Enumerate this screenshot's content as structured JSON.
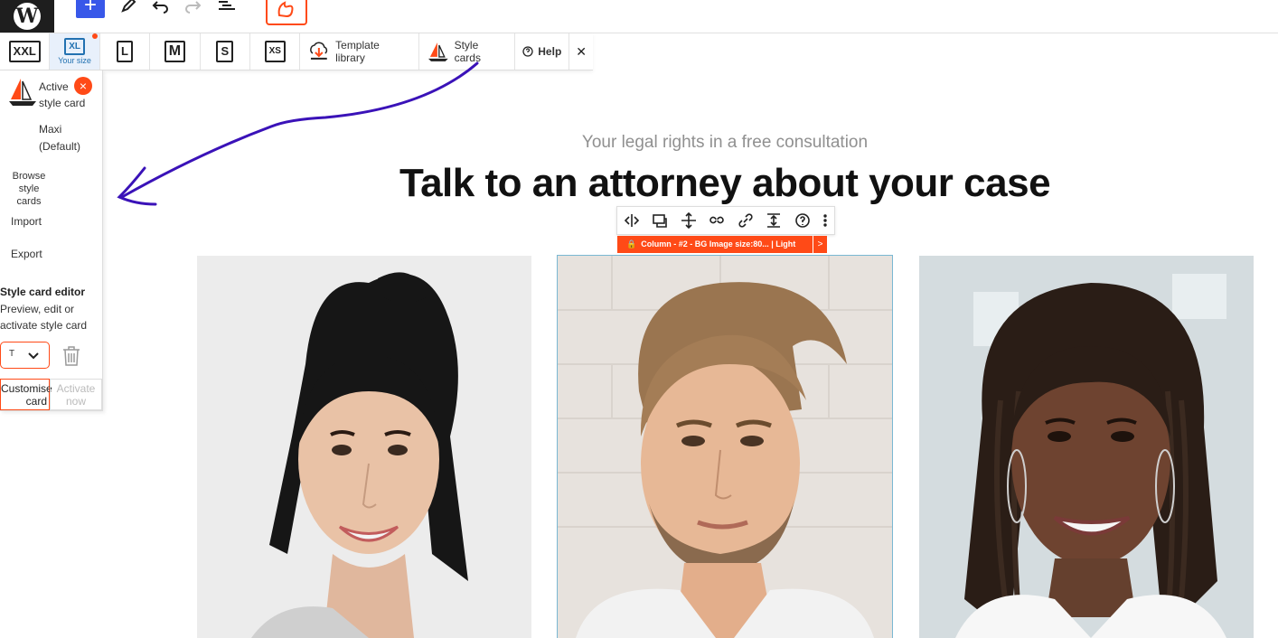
{
  "topbar": {
    "add_label": "+"
  },
  "responsive": {
    "sizes": [
      {
        "label": "XXL"
      },
      {
        "label": "XL",
        "caption": "Your size"
      },
      {
        "label": "L"
      },
      {
        "label": "M"
      },
      {
        "label": "S"
      },
      {
        "label": "XS"
      }
    ],
    "template_library": "Template library",
    "style_cards": "Style cards",
    "help": "Help",
    "close": "✕"
  },
  "style_cards_panel": {
    "active_label": "Active style card",
    "current_card": "Maxi (Default)",
    "browse": "Browse style cards",
    "import": "Import",
    "export": "Export",
    "editor_title": "Style card editor",
    "editor_desc": "Preview, edit or activate style card",
    "select_value": "T",
    "customise": "Customise card",
    "activate": "Activate now"
  },
  "content": {
    "subtitle": "Your legal rights in a free consultation",
    "heading": "Talk to an attorney about your case",
    "block_label": "Column - #2 - BG Image size:80... | Light",
    "block_label_arrow": ">"
  },
  "colors": {
    "accent": "#ff4a17",
    "wp_blue": "#3858e9",
    "annotation": "#3a12b8"
  }
}
